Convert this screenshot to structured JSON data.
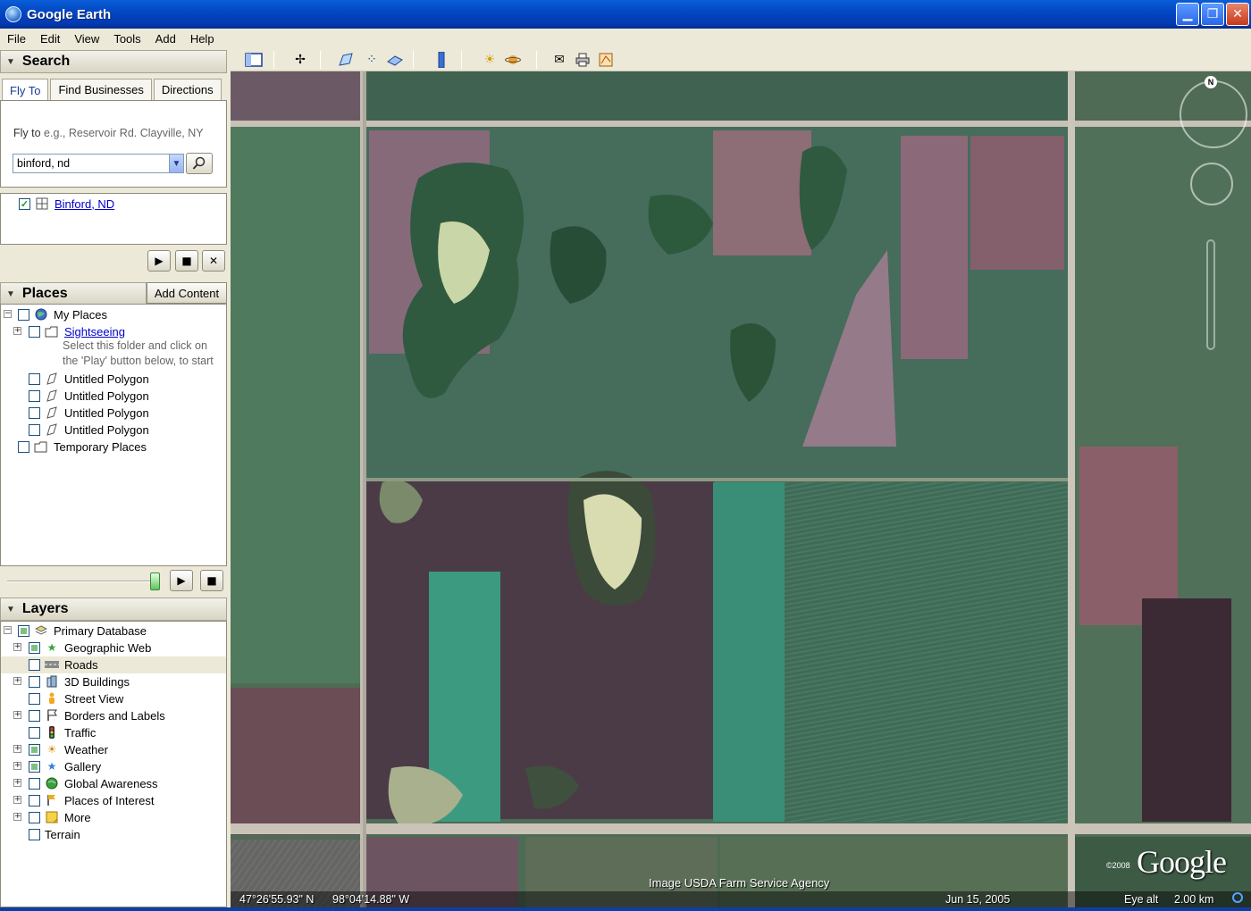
{
  "window": {
    "title": "Google Earth"
  },
  "menu": [
    "File",
    "Edit",
    "View",
    "Tools",
    "Add",
    "Help"
  ],
  "search": {
    "header": "Search",
    "tabs": [
      "Fly To",
      "Find Businesses",
      "Directions"
    ],
    "fly_to_label": "Fly to",
    "fly_to_hint": "e.g., Reservoir Rd. Clayville, NY",
    "input_value": "binford, nd",
    "result": "Binford, ND"
  },
  "places": {
    "header": "Places",
    "add_content": "Add Content",
    "my_places": "My Places",
    "sightseeing": "Sightseeing",
    "sightseeing_desc_1": "Select this folder and click on",
    "sightseeing_desc_2": "the 'Play' button below, to start",
    "polygons": [
      "Untitled Polygon",
      "Untitled Polygon",
      "Untitled Polygon",
      "Untitled Polygon"
    ],
    "temporary": "Temporary Places"
  },
  "layers": {
    "header": "Layers",
    "primary": "Primary Database",
    "items": [
      "Geographic Web",
      "Roads",
      "3D Buildings",
      "Street View",
      "Borders and Labels",
      "Traffic",
      "Weather",
      "Gallery",
      "Global Awareness",
      "Places of Interest",
      "More"
    ],
    "terrain": "Terrain"
  },
  "map": {
    "attribution": "Image USDA Farm Service Agency",
    "lat": "47°26'55.93\" N",
    "lon": "98°04'14.88\" W",
    "date": "Jun 15, 2005",
    "eye_alt_label": "Eye alt",
    "eye_alt_value": "2.00 km",
    "logo": "Google",
    "copyright": "©2008",
    "north": "N"
  }
}
